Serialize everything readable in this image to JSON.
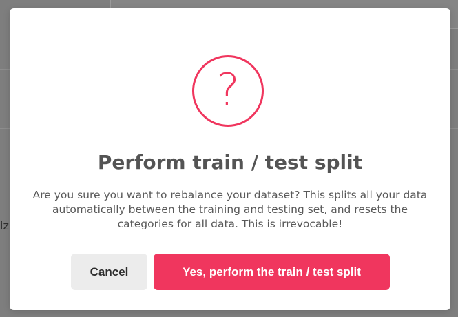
{
  "background": {
    "left_partial_text": "iz"
  },
  "dialog": {
    "icon": "question-mark-icon",
    "icon_glyph": "?",
    "title": "Perform train / test split",
    "message": "Are you sure you want to rebalance your dataset? This splits all your data automatically between the training and testing set, and resets the categories for all data. This is irrevocable!",
    "cancel_label": "Cancel",
    "confirm_label": "Yes, perform the train / test split"
  },
  "colors": {
    "accent": "#f0365e",
    "cancel_bg": "#ececec",
    "title_text": "#545454",
    "overlay": "#7e7e7e"
  }
}
